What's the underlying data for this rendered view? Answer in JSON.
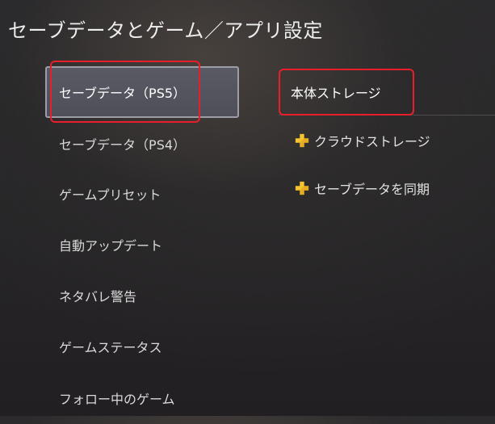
{
  "header": {
    "title": "セーブデータとゲーム／アプリ設定"
  },
  "left_menu": {
    "items": [
      {
        "label": "セーブデータ（PS5）",
        "selected": true
      },
      {
        "label": "セーブデータ（PS4）"
      },
      {
        "label": "ゲームプリセット"
      },
      {
        "label": "自動アップデート"
      },
      {
        "label": "ネタバレ警告"
      },
      {
        "label": "ゲームステータス"
      },
      {
        "label": "フォロー中のゲーム"
      }
    ]
  },
  "right_panel": {
    "items": [
      {
        "label": "本体ストレージ"
      },
      {
        "label": "クラウドストレージ",
        "icon": "ps-plus-icon"
      },
      {
        "label": "セーブデータを同期",
        "icon": "ps-plus-icon"
      }
    ]
  },
  "colors": {
    "highlight_border": "#e81f2a",
    "ps_plus": "#f4c531",
    "selected_bg": "#55555f"
  }
}
